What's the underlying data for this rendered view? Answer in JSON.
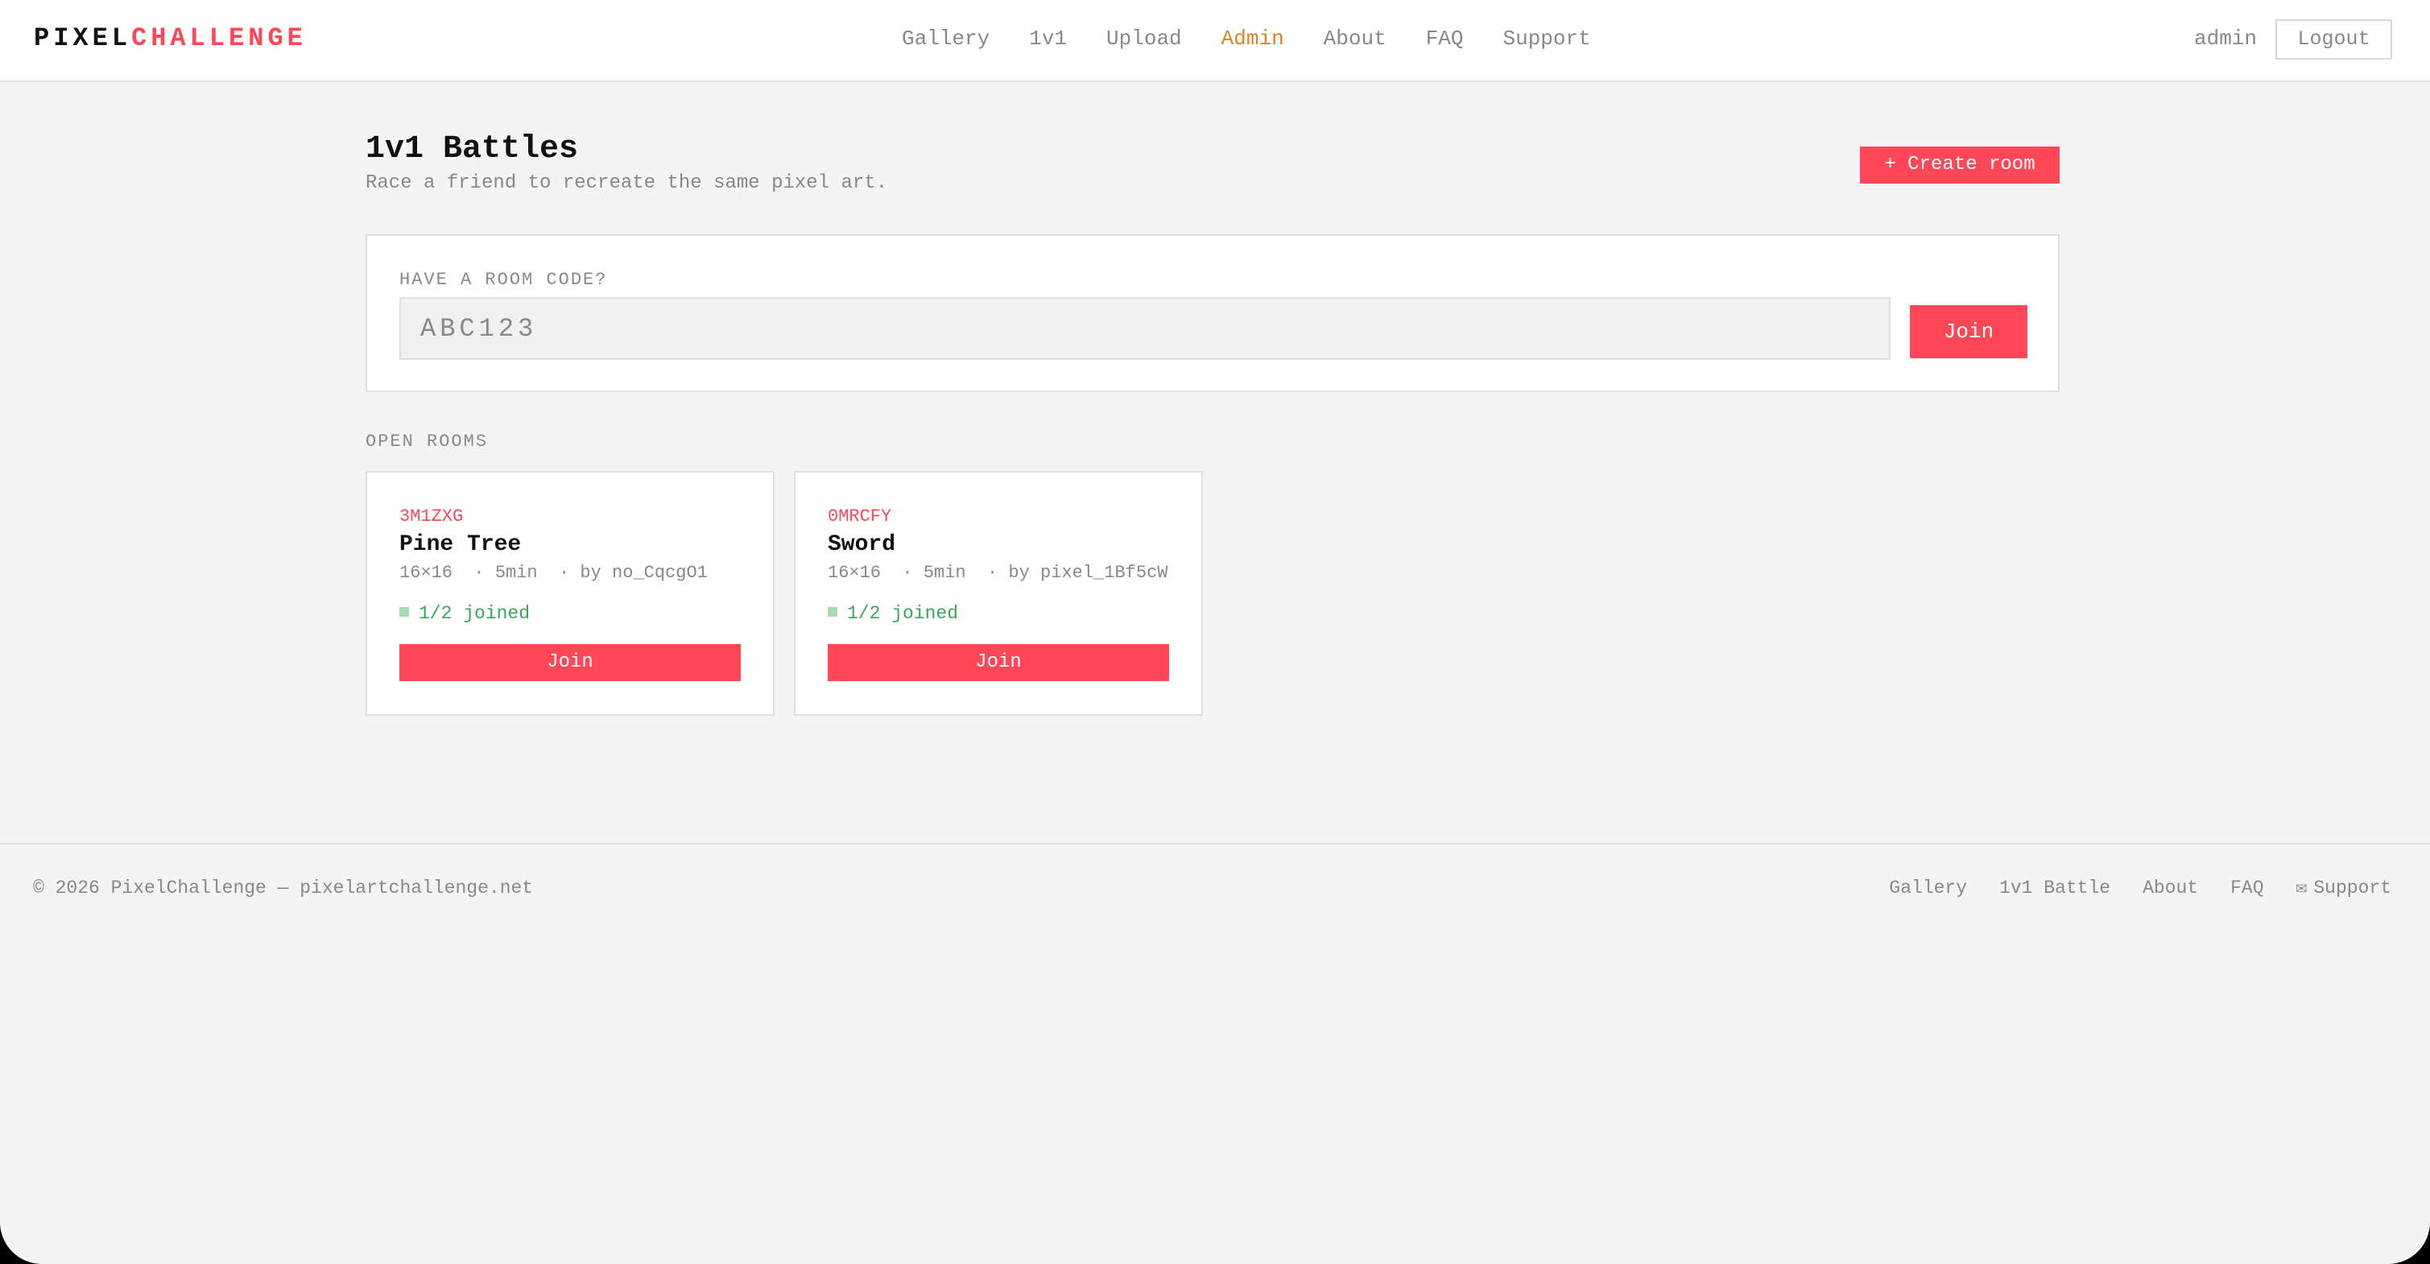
{
  "header": {
    "logo_part1": "PIXEL",
    "logo_part2": "CHALLENGE",
    "nav": [
      "Gallery",
      "1v1",
      "Upload",
      "Admin",
      "About",
      "FAQ",
      "Support"
    ],
    "active_nav": "Admin",
    "user": "admin",
    "logout_label": "Logout"
  },
  "page": {
    "title": "1v1 Battles",
    "subtitle": "Race a friend to recreate the same pixel art.",
    "create_label": "+ Create room"
  },
  "room_code": {
    "label": "HAVE A ROOM CODE?",
    "placeholder": "ABC123",
    "value": "",
    "join_label": "Join"
  },
  "open_rooms": {
    "label": "OPEN ROOMS",
    "rooms": [
      {
        "code": "3M1ZXG",
        "title": "Pine Tree",
        "meta": "16×16  · 5min  · by no_CqcgO1",
        "status": "1/2 joined",
        "join_label": "Join"
      },
      {
        "code": "0MRCFY",
        "title": "Sword",
        "meta": "16×16  · 5min  · by pixel_1Bf5cW",
        "status": "1/2 joined",
        "join_label": "Join"
      }
    ]
  },
  "footer": {
    "copyright": "© 2026 PixelChallenge — pixelartchallenge.net",
    "links": [
      "Gallery",
      "1v1 Battle",
      "About",
      "FAQ",
      "Support"
    ],
    "support_icon": "mail-icon"
  },
  "colors": {
    "accent": "#ff4757",
    "active_nav": "#e67e22",
    "status_green": "#3aa55d",
    "background": "#f4f4f4"
  }
}
